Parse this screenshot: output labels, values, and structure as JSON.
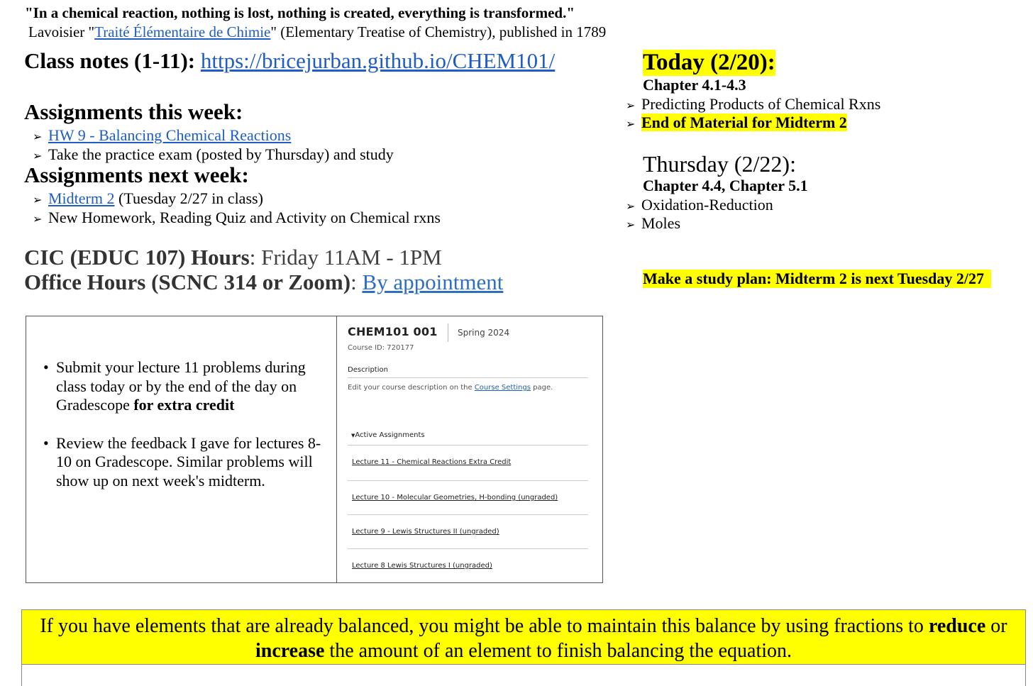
{
  "quote": "\"In a chemical reaction, nothing is lost, nothing is created, everything is transformed.\"",
  "attribution": {
    "prefix": "Lavoisier \"",
    "link": "Traité Élémentaire de Chimie",
    "suffix": "\" (Elementary Treatise of Chemistry), published in 1789"
  },
  "class_notes": {
    "label": "Class notes (1-11): ",
    "link": "https://bricejurban.github.io/CHEM101/"
  },
  "this_week": {
    "heading": "Assignments this week:",
    "items": [
      {
        "link": "HW 9 - Balancing Chemical Reactions",
        "text": ""
      },
      {
        "link": "",
        "text": "Take the practice exam (posted by Thursday) and study"
      }
    ]
  },
  "next_week": {
    "heading": "Assignments next week:",
    "items": [
      {
        "link": "Midterm 2",
        "text": " (Tuesday 2/27 in class)"
      },
      {
        "link": "",
        "text": "New Homework, Reading Quiz and Activity on Chemical rxns"
      }
    ]
  },
  "cic": {
    "label": "CIC (EDUC 107) Hours",
    "value": ": Friday 11AM - 1PM"
  },
  "office": {
    "label": "Office Hours (SCNC 314 or Zoom)",
    "sep": ": ",
    "link": "By appointment"
  },
  "today": {
    "title": "Today (2/20):",
    "chapter": "Chapter 4.1-4.3",
    "items": [
      "Predicting Products of Chemical Rxns",
      "End of Material for Midterm 2"
    ]
  },
  "thursday": {
    "title": "Thursday (2/22):",
    "chapter": "Chapter 4.4, Chapter 5.1",
    "items": [
      "Oxidation-Reduction",
      "Moles"
    ]
  },
  "study_plan": "Make a study plan: Midterm 2 is next Tuesday 2/27",
  "box": {
    "bullet1": {
      "text": "Submit your lecture 11 problems during class today or by the end of the day on Gradescope ",
      "bold": "for extra credit"
    },
    "bullet2": "Review the feedback I gave for lectures 8-10 on Gradescope. Similar problems will show up on next week's midterm.",
    "course": {
      "title": "CHEM101 001",
      "term": "Spring 2024",
      "id": "Course ID: 720177",
      "description_label": "Description",
      "description_prefix": "Edit your course description on the ",
      "description_link": "Course Settings",
      "description_suffix": " page.",
      "active_label": "Active Assignments",
      "assignments": [
        "Lecture 11 - Chemical Reactions Extra Credit",
        "Lecture 10 - Molecular Geometries, H-bonding (ungraded)",
        "Lecture 9 - Lewis Structures II (ungraded)",
        "Lecture 8 Lewis Structures I (ungraded)"
      ]
    }
  },
  "banner": {
    "part1": "If you have elements that are already balanced, you might be able to maintain this balance by using fractions to ",
    "bold1": "reduce",
    "part2": " or ",
    "bold2": "increase",
    "part3": " the amount of an element to finish balancing the equation."
  },
  "colors": {
    "highlight": "#ffff00",
    "link": "#1f5cc4"
  }
}
